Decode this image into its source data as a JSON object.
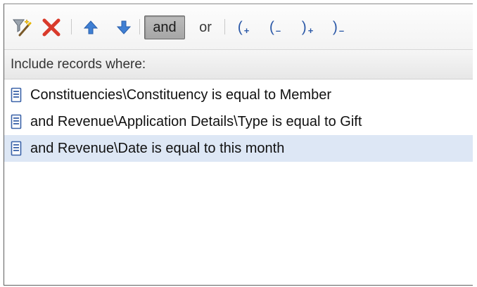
{
  "toolbar": {
    "buttons": [
      {
        "name": "filter-wand",
        "icon": "magic-filter-icon"
      },
      {
        "name": "delete",
        "icon": "red-x-icon"
      },
      {
        "name": "move-up",
        "icon": "arrow-up-icon"
      },
      {
        "name": "move-down",
        "icon": "arrow-down-icon"
      }
    ],
    "and_label": "and",
    "or_label": "or",
    "open_paren_add": "(",
    "open_paren_remove": "(",
    "close_paren_add": ")",
    "close_paren_remove": ")",
    "plus": "+",
    "minus": "–",
    "accent_color": "#2d5aa8",
    "delete_color": "#d93a2b"
  },
  "header": {
    "label": "Include records where:"
  },
  "criteria": [
    {
      "text": "Constituencies\\Constituency is equal to Member",
      "selected": false,
      "icon": "record-icon"
    },
    {
      "text": "and Revenue\\Application Details\\Type is equal to Gift",
      "selected": false,
      "icon": "record-icon"
    },
    {
      "text": "and Revenue\\Date is equal to this month",
      "selected": true,
      "icon": "record-icon"
    }
  ]
}
